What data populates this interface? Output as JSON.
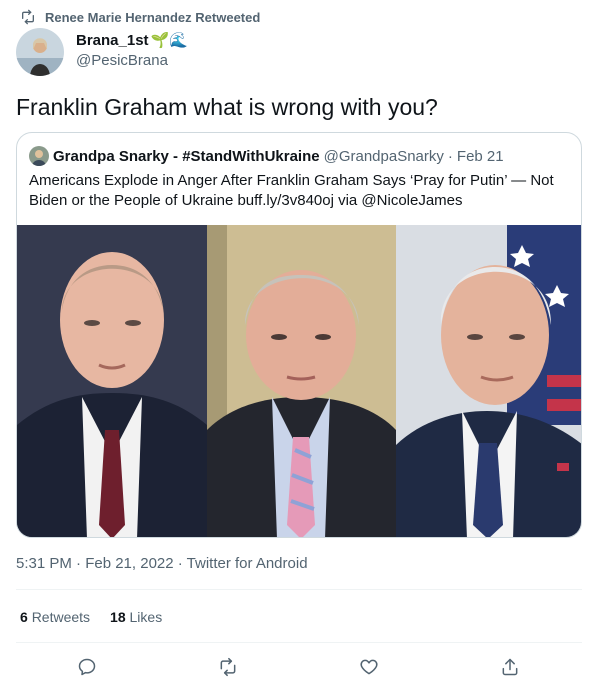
{
  "retweet": {
    "icon": "retweet-icon",
    "text": "Renee Marie Hernandez Retweeted"
  },
  "author": {
    "name": "Brana_1st",
    "emoji": "🌱🌊",
    "handle": "@PesicBrana"
  },
  "tweet": {
    "text": "Franklin Graham what is wrong with you?"
  },
  "quote": {
    "name": "Grandpa Snarky - #StandWithUkraine",
    "handle": "@GrandpaSnarky",
    "sep": "·",
    "date": "Feb 21",
    "body": "Americans Explode in Anger After Franklin Graham Says ‘Pray for Putin’ — Not Biden or the People of Ukraine buff.ly/3v840oj via @NicoleJames"
  },
  "meta": {
    "text": "5:31 PM · Feb 21, 2022 · Twitter for Android"
  },
  "stats": {
    "retweets_count": "6",
    "retweets_label": "Retweets",
    "likes_count": "18",
    "likes_label": "Likes"
  },
  "actions": [
    "reply-icon",
    "retweet-icon",
    "like-icon",
    "share-icon"
  ],
  "colors": {
    "text": "#0f1419",
    "secondary": "#536471",
    "border": "#cfd9de"
  }
}
